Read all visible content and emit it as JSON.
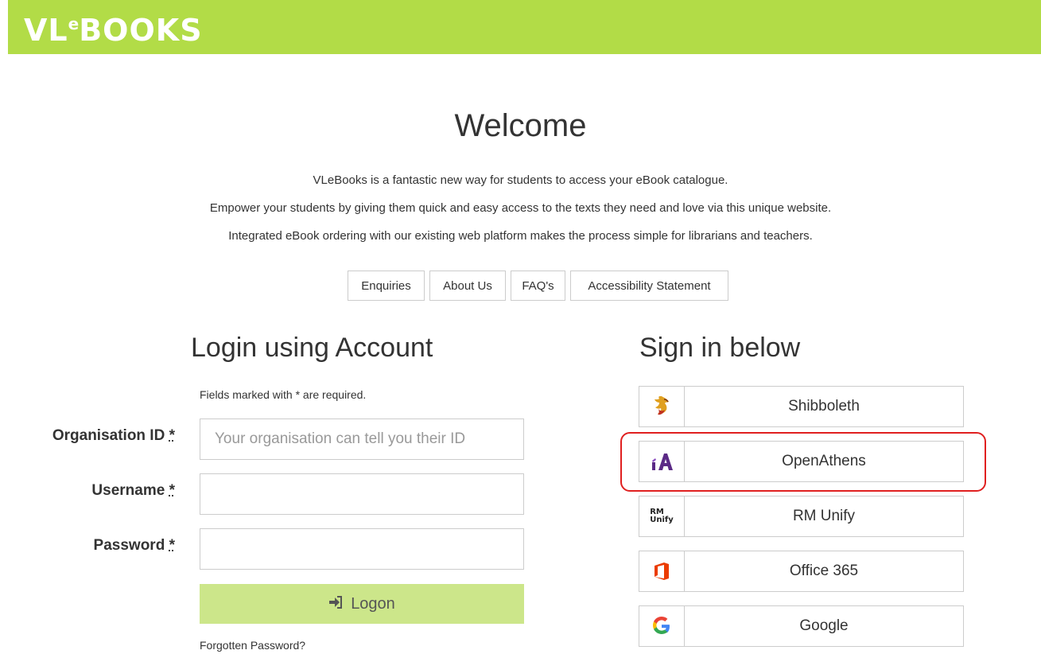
{
  "header": {
    "logo_text": "VL",
    "logo_e": "e",
    "logo_rest": "BOOKS",
    "brand_color": "#b2dc47"
  },
  "welcome": {
    "title": "Welcome",
    "lines": [
      "VLeBooks is a fantastic new way for students to access your eBook catalogue.",
      "Empower your students by giving them quick and easy access to the texts they need and love via this unique website.",
      "Integrated eBook ordering with our existing web platform makes the process simple for librarians and teachers."
    ]
  },
  "nav": {
    "enquiries": "Enquiries",
    "about": "About Us",
    "faq": "FAQ's",
    "accessibility": "Accessibility Statement"
  },
  "login": {
    "title": "Login using Account",
    "required_note": "Fields marked with * are required.",
    "org_label": "Organisation ID",
    "org_placeholder": "Your organisation can tell you their ID",
    "username_label": "Username",
    "password_label": "Password",
    "asterisk": "*",
    "logon_label": "Logon",
    "forgot_label": "Forgotten Password?"
  },
  "signin": {
    "title": "Sign in below",
    "providers": [
      {
        "label": "Shibboleth",
        "icon": "shibboleth-icon"
      },
      {
        "label": "OpenAthens",
        "icon": "openathens-icon"
      },
      {
        "label": "RM Unify",
        "icon": "rm-unify-icon",
        "icon_text_1": "RM",
        "icon_text_2": "Unify"
      },
      {
        "label": "Office 365",
        "icon": "office-365-icon"
      },
      {
        "label": "Google",
        "icon": "google-icon"
      }
    ]
  }
}
